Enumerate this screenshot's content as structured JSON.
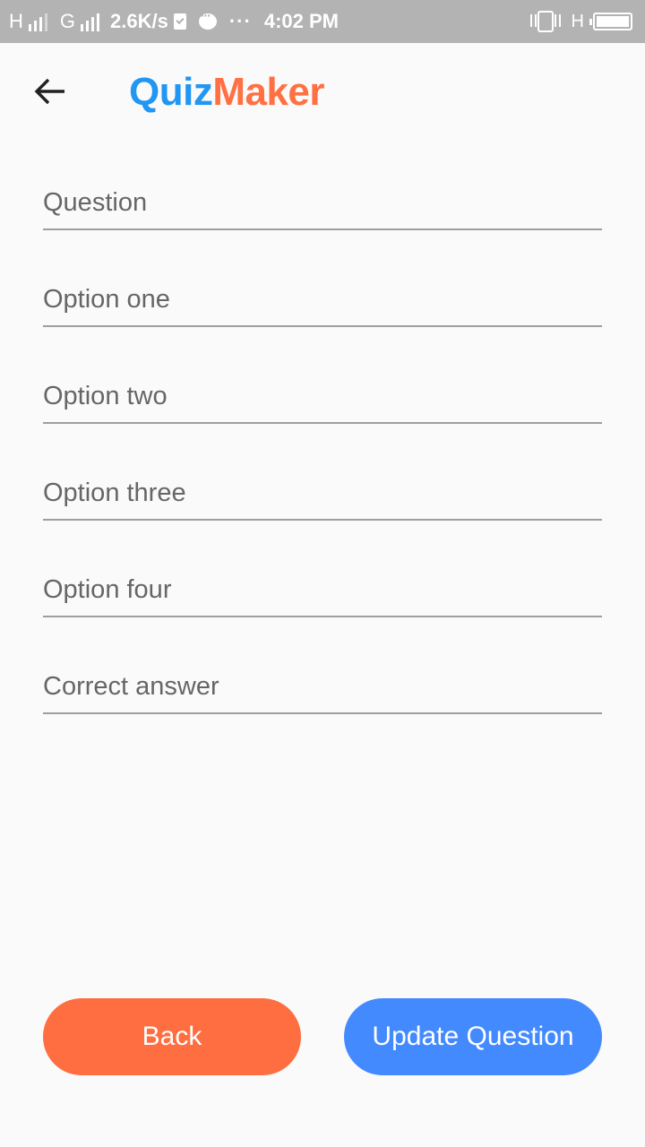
{
  "status_bar": {
    "sim1_letter": "H",
    "sim2_letter": "G",
    "speed": "2.6K/s",
    "more": "···",
    "time": "4:02 PM",
    "hplus": "H"
  },
  "app_bar": {
    "title_part1": "Quiz",
    "title_part2": "Maker",
    "title_color1": "#2196f3",
    "title_color2": "#ff7043"
  },
  "form": {
    "fields": [
      {
        "placeholder": "Question",
        "value": ""
      },
      {
        "placeholder": "Option one",
        "value": ""
      },
      {
        "placeholder": "Option two",
        "value": ""
      },
      {
        "placeholder": "Option three",
        "value": ""
      },
      {
        "placeholder": "Option four",
        "value": ""
      },
      {
        "placeholder": "Correct answer",
        "value": ""
      }
    ]
  },
  "buttons": {
    "back_label": "Back",
    "update_label": "Update Question",
    "back_color": "#ff6e40",
    "update_color": "#448aff"
  }
}
